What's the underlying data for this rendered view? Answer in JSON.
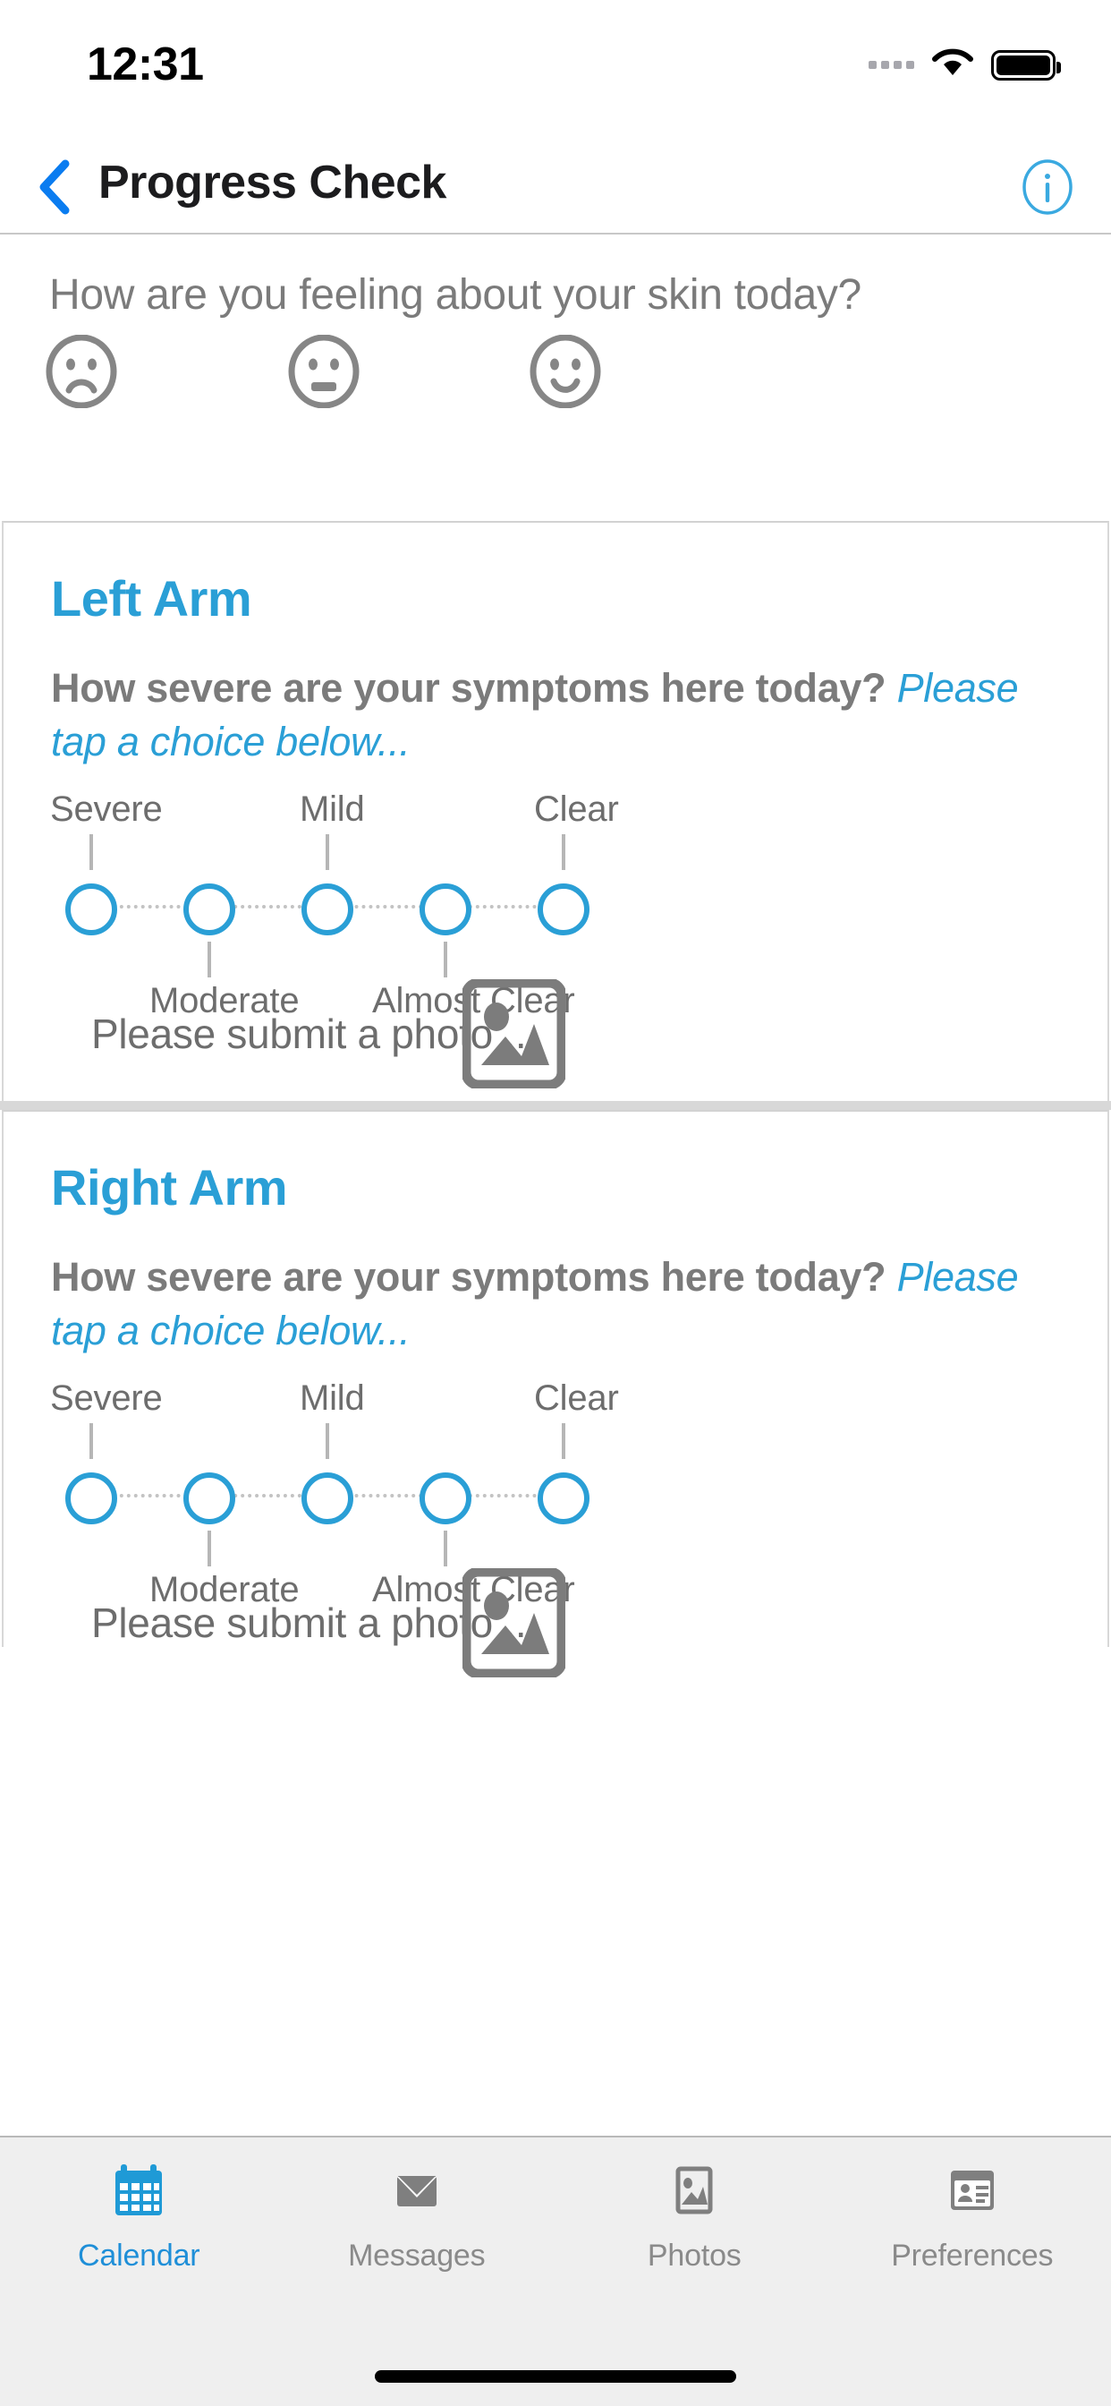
{
  "status_bar": {
    "time": "12:31",
    "signal_icon": "signal-dots-icon",
    "wifi_icon": "wifi-icon",
    "battery_icon": "battery-full-icon"
  },
  "nav_bar": {
    "back_icon": "chevron-left-icon",
    "title": "Progress Check",
    "info_icon": "info-circle-icon"
  },
  "mood": {
    "question": "How are you feeling about your skin today?",
    "options": [
      {
        "icon": "sad-face-icon",
        "label": "Sad"
      },
      {
        "icon": "neutral-face-icon",
        "label": "Neutral"
      },
      {
        "icon": "happy-face-icon",
        "label": "Happy"
      }
    ]
  },
  "severity_scale": {
    "labels_above": [
      "Severe",
      "Mild",
      "Clear"
    ],
    "labels_below": [
      "Moderate",
      "Almost Clear"
    ],
    "steps": [
      "Severe",
      "Moderate",
      "Mild",
      "Almost Clear",
      "Clear"
    ],
    "selected": null,
    "node_color": "#2a9fd6"
  },
  "cards": [
    {
      "title": "Left Arm",
      "question_bold": "How severe are your symptoms here today?",
      "question_hint": "Please tap a choice below...",
      "photo_prompt": "Please submit a photo ...",
      "photo_icon": "image-placeholder-icon"
    },
    {
      "title": "Right Arm",
      "question_bold": "How severe are your symptoms here today?",
      "question_hint": "Please tap a choice below...",
      "photo_prompt": "Please submit a photo ...",
      "photo_icon": "image-placeholder-icon"
    }
  ],
  "tab_bar": {
    "active_color": "#1f8fd8",
    "inactive_color": "#8a8a8a",
    "items": [
      {
        "label": "Calendar",
        "icon": "calendar-icon",
        "active": true
      },
      {
        "label": "Messages",
        "icon": "envelope-icon",
        "active": false
      },
      {
        "label": "Photos",
        "icon": "photo-icon",
        "active": false
      },
      {
        "label": "Preferences",
        "icon": "contact-card-icon",
        "active": false
      }
    ]
  }
}
